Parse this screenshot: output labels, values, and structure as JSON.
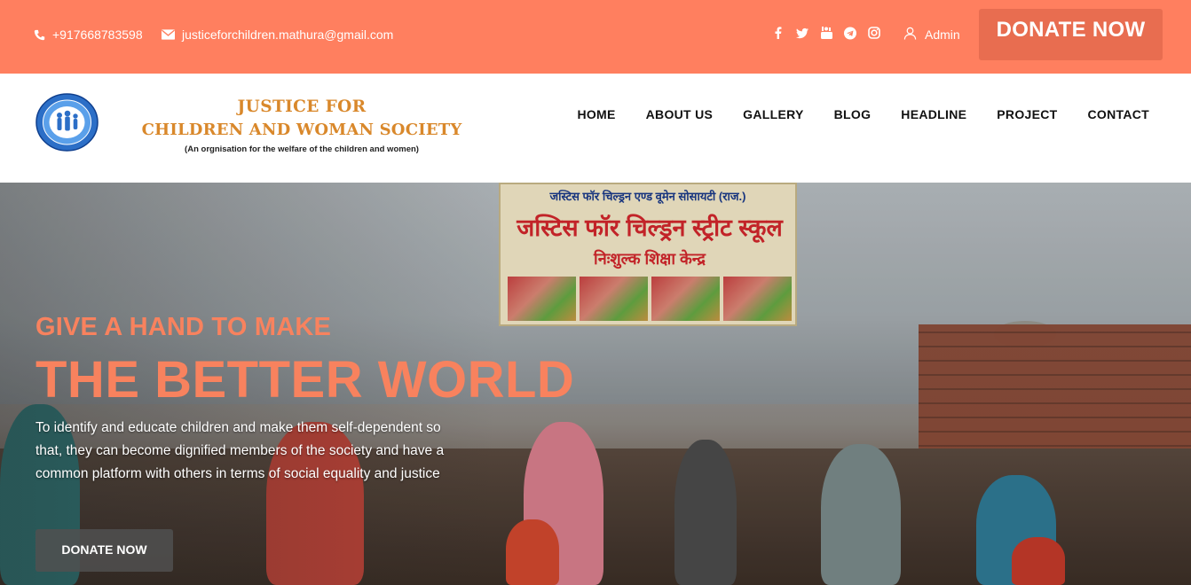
{
  "topbar": {
    "phone": "+917668783598",
    "email": "justiceforchildren.mathura@gmail.com",
    "socials": [
      "facebook-icon",
      "twitter-icon",
      "youtube-icon",
      "telegram-icon",
      "instagram-icon"
    ],
    "admin_label": "Admin",
    "donate_label": "DONATE NOW"
  },
  "brand": {
    "line1": "JUSTICE FOR",
    "line2": "CHILDREN AND WOMAN SOCIETY",
    "tagline": "(An orgnisation for the welfare of the children and women)"
  },
  "nav": {
    "items": [
      "HOME",
      "ABOUT US",
      "GALLERY",
      "BLOG",
      "HEADLINE",
      "PROJECT",
      "CONTACT"
    ]
  },
  "hero": {
    "kicker": "GIVE A HAND TO MAKE",
    "headline": "THE BETTER WORLD",
    "description": "To identify and educate children and make them self-dependent so that, they can become dignified members of the society and have a common platform with others in terms of social equality and justice",
    "donate_label": "DONATE NOW",
    "banner": {
      "line1": "जस्टिस फॉर चिल्ड्रन एण्ड वूमेन सोसायटी (राज.)",
      "line2": "जस्टिस फॉर चिल्ड्रन स्ट्रीट स्कूल",
      "line3": "निःशुल्क शिक्षा केन्द्र"
    }
  },
  "colors": {
    "accent": "#ff7f5f",
    "donate_dark": "#e86d50",
    "brand_text": "#d9882b",
    "hero_text": "#f8825e"
  }
}
